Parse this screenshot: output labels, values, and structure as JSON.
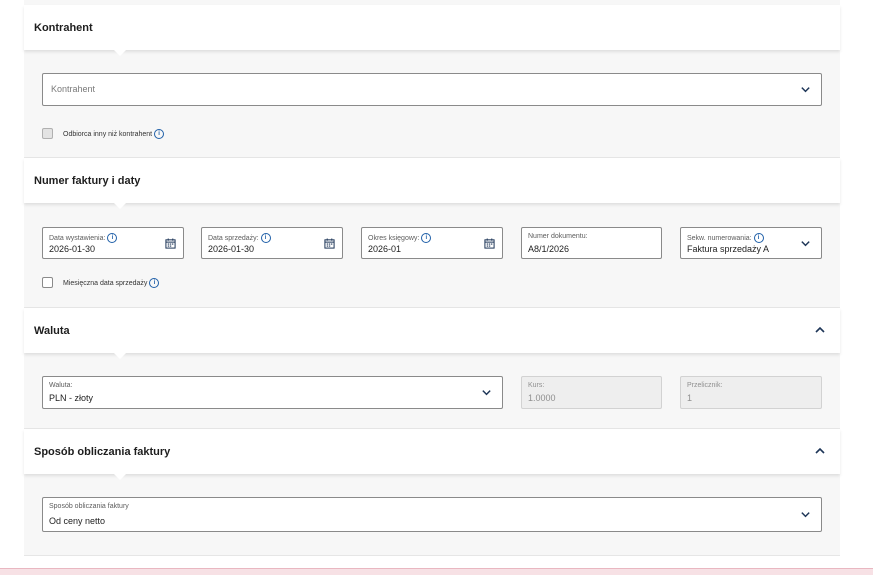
{
  "sections": {
    "kontrahent": {
      "title": "Kontrahent"
    },
    "numer": {
      "title": "Numer faktury i daty"
    },
    "waluta": {
      "title": "Waluta"
    },
    "sposob": {
      "title": "Sposób obliczania faktury"
    }
  },
  "kontrahent": {
    "placeholder": "Kontrahent",
    "checkbox_label": "Odbiorca inny niż kontrahent",
    "checkbox_checked": false
  },
  "numer": {
    "data_wystawienia": {
      "label": "Data wystawienia:",
      "value": "2026-01-30"
    },
    "data_sprzedazy": {
      "label": "Data sprzedaży:",
      "value": "2026-01-30"
    },
    "okres_ksiegowy": {
      "label": "Okres księgowy:",
      "value": "2026-01"
    },
    "numer_dokumentu": {
      "label": "Numer dokumentu:",
      "value": "A8/1/2026"
    },
    "sekw_numerowania": {
      "label": "Sekw. numerowania:",
      "value": "Faktura sprzedaży A"
    },
    "checkbox_label": "Miesięczna data sprzedaży",
    "checkbox_checked": false
  },
  "waluta": {
    "waluta": {
      "label": "Waluta:",
      "value": "PLN - złoty"
    },
    "kurs": {
      "label": "Kurs:",
      "value": "1.0000"
    },
    "przelicznik": {
      "label": "Przelicznik:",
      "value": "1"
    }
  },
  "sposob": {
    "label": "Sposób obliczania faktury",
    "value": "Od ceny netto"
  },
  "icons": {
    "info": "i",
    "info_color": "#1f5fa8",
    "chevron_color": "#1d3557"
  }
}
